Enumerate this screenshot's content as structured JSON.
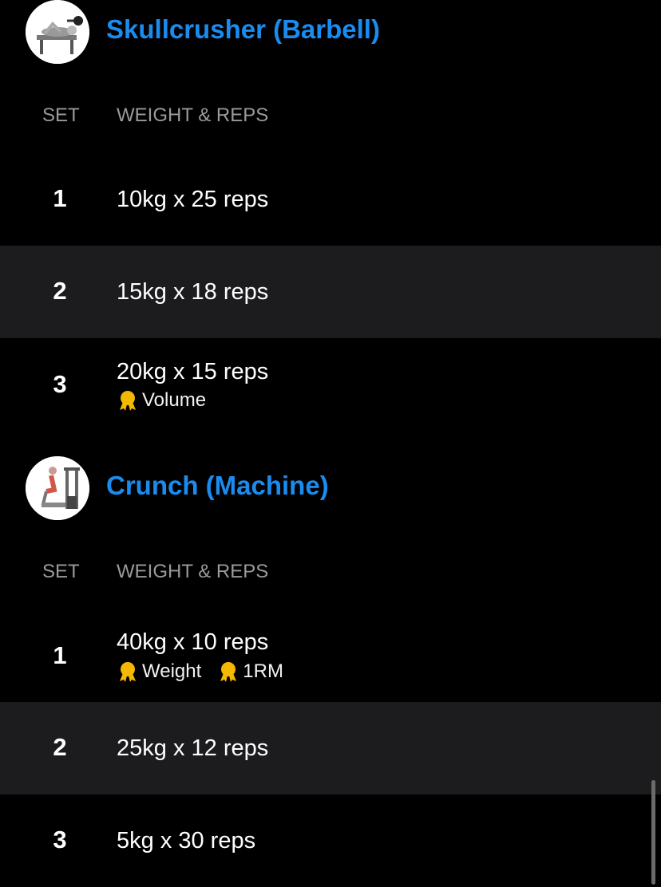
{
  "exercises": [
    {
      "title": "Skullcrusher (Barbell)",
      "thumbnail_icon": "skullcrusher-illustration",
      "columns": {
        "set": "SET",
        "weight_reps": "WEIGHT & REPS"
      },
      "sets": [
        {
          "set": "1",
          "weight_reps": "10kg x 25 reps",
          "badges": []
        },
        {
          "set": "2",
          "weight_reps": "15kg x 18 reps",
          "badges": []
        },
        {
          "set": "3",
          "weight_reps": "20kg x 15 reps",
          "badges": [
            "Volume"
          ]
        }
      ]
    },
    {
      "title": "Crunch (Machine)",
      "thumbnail_icon": "crunch-machine-illustration",
      "columns": {
        "set": "SET",
        "weight_reps": "WEIGHT & REPS"
      },
      "sets": [
        {
          "set": "1",
          "weight_reps": "40kg x 10 reps",
          "badges": [
            "Weight",
            "1RM"
          ]
        },
        {
          "set": "2",
          "weight_reps": "25kg x 12 reps",
          "badges": []
        },
        {
          "set": "3",
          "weight_reps": "5kg x 30 reps",
          "badges": []
        }
      ]
    }
  ],
  "colors": {
    "accent": "#1a8cf0",
    "background": "#000000",
    "shaded_row": "#1c1c1e",
    "muted_text": "#9a9a9a",
    "medal": "#f5b800"
  },
  "icons": {
    "record_badge": "medal-icon"
  }
}
